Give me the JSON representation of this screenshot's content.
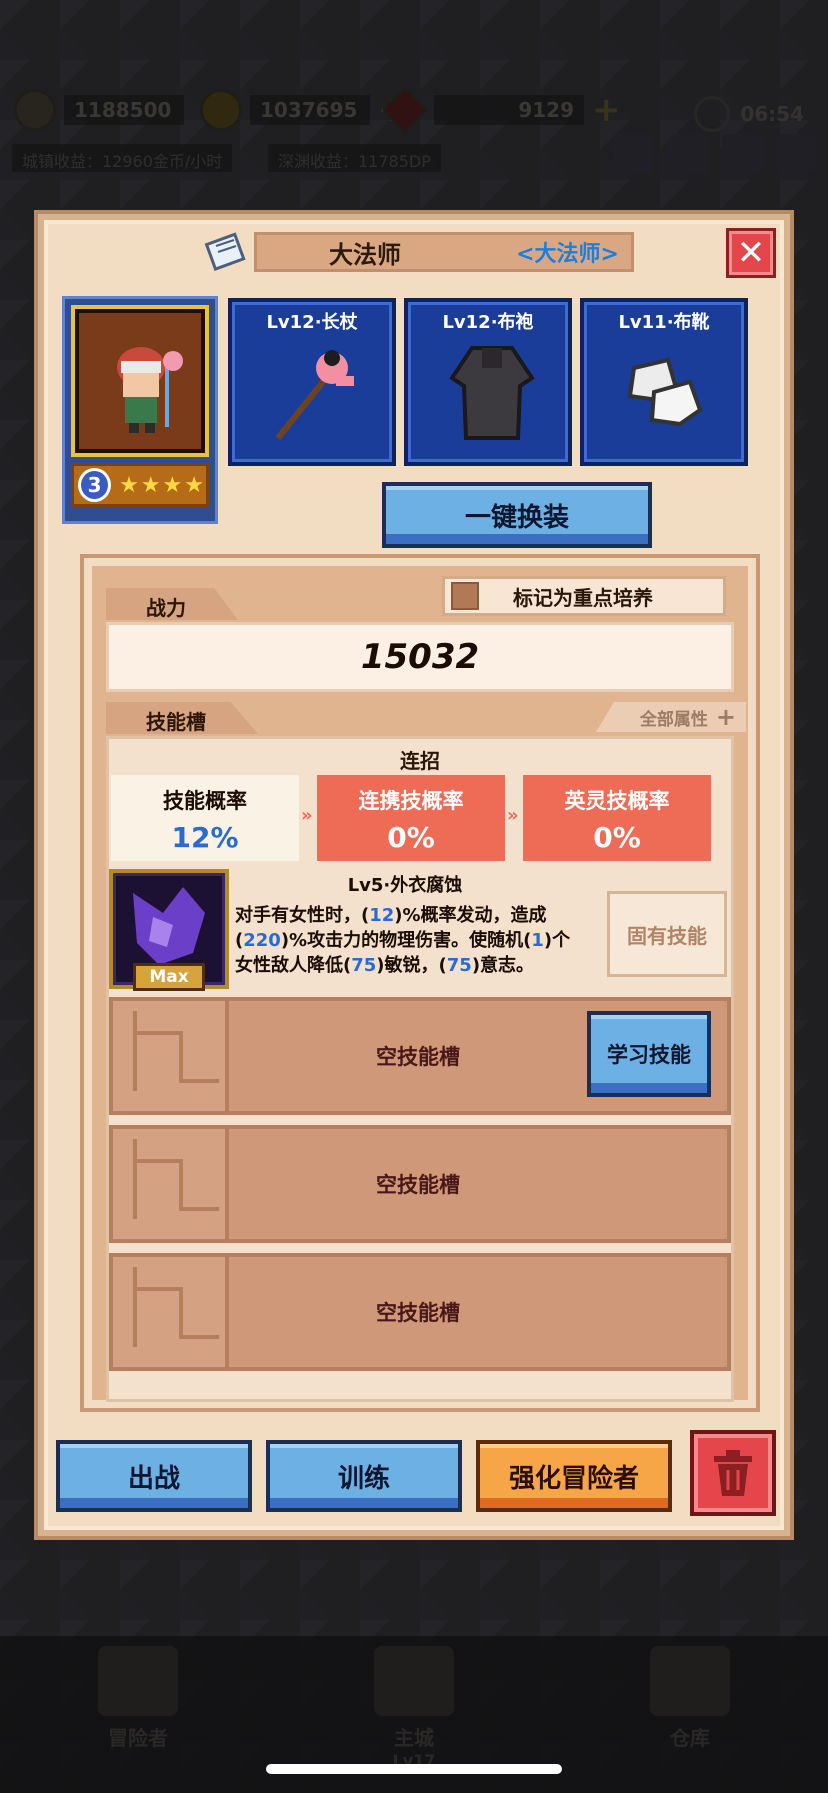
{
  "background": {
    "resources": {
      "gem_count": "1188500",
      "gold": "1037695",
      "crystal": "9129",
      "city_income": "城镇收益：12960金币/小时",
      "abyss_income": "深渊收益：11785DP",
      "time": "06:54"
    },
    "bottom_nav": {
      "adventurer": "冒险者",
      "main_city": "主城",
      "main_city_level": "Lv17",
      "warehouse": "仓库"
    }
  },
  "modal": {
    "hero_name": "大法师",
    "hero_class": "<大法师>",
    "close_glyph": "✕",
    "rank": "3",
    "stars": "★★★★",
    "equipment": [
      {
        "label": "Lv12·长杖",
        "icon": "staff-icon"
      },
      {
        "label": "Lv12·布袍",
        "icon": "robe-icon"
      },
      {
        "label": "Lv11·布靴",
        "icon": "boots-icon"
      }
    ],
    "quick_equip": "一键换装",
    "power_tab": "战力",
    "focus_label": "标记为重点培养",
    "power_value": "15032",
    "all_attributes": "全部属性",
    "plus_glyph": "+",
    "skill_tab": "技能槽",
    "combo": {
      "title": "连招",
      "rates": [
        {
          "label": "技能概率",
          "value": "12%"
        },
        {
          "label": "连携技概率",
          "value": "0%"
        },
        {
          "label": "英灵技概率",
          "value": "0%"
        }
      ],
      "chevron": "»"
    },
    "owned_skill": {
      "max_label": "Max",
      "name": "Lv5·外衣腐蚀",
      "desc_parts": {
        "p1": "对手有女性时，(",
        "n1": "12",
        "p2": ")%概率发动，造成(",
        "n2": "220",
        "p3": ")%攻击力的物理伤害。使随机(",
        "n3": "1",
        "p4": ")个女性敌人降低(",
        "n4": "75",
        "p5": ")敏锐，(",
        "n5": "75",
        "p6": ")意志。"
      },
      "inherent": "固有技能"
    },
    "empty_slot_label": "空技能槽",
    "learn_skill": "学习技能",
    "buttons": {
      "deploy": "出战",
      "train": "训练",
      "enhance": "强化冒险者"
    }
  },
  "colors": {
    "accent_blue": "#2a6bd0",
    "combo_red": "#ee6b55",
    "modal_bg": "#f2dcc2"
  }
}
